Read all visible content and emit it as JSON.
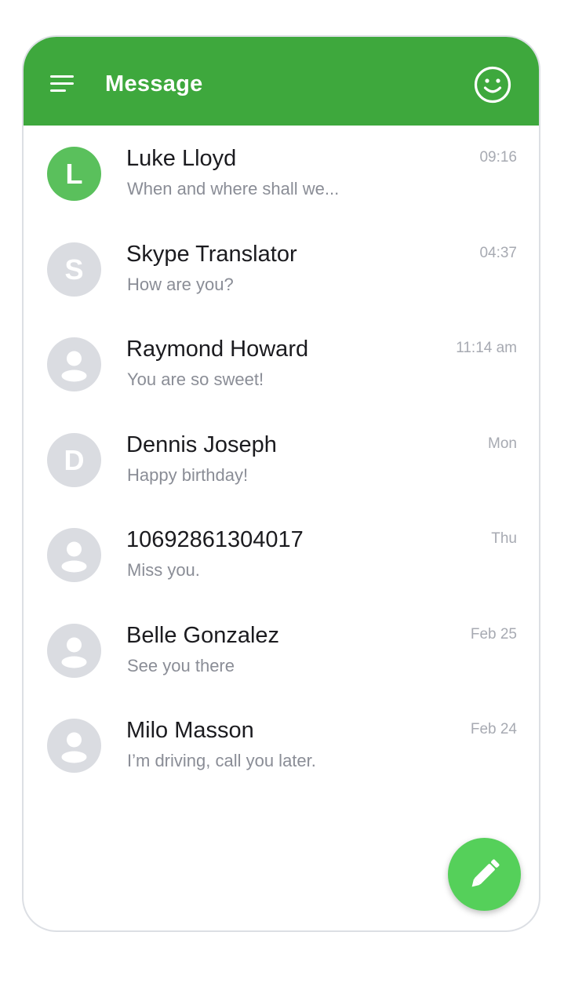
{
  "header": {
    "title": "Message",
    "menu_icon": "hamburger-menu-icon",
    "action_icon": "smiley-face-icon",
    "color": "#3ea83d"
  },
  "conversations": [
    {
      "avatar_type": "letter",
      "avatar_letter": "L",
      "avatar_color": "#5ac05c",
      "name": "Luke Lloyd",
      "preview": "When and where shall we...",
      "time": "09:16"
    },
    {
      "avatar_type": "letter",
      "avatar_letter": "S",
      "avatar_color": "#dadce1",
      "name": "Skype Translator",
      "preview": "How are you?",
      "time": "04:37"
    },
    {
      "avatar_type": "person",
      "avatar_letter": "",
      "avatar_color": "#dadce1",
      "name": "Raymond Howard",
      "preview": "You are so sweet!",
      "time": "11:14 am"
    },
    {
      "avatar_type": "letter",
      "avatar_letter": "D",
      "avatar_color": "#dadce1",
      "name": "Dennis Joseph",
      "preview": "Happy birthday!",
      "time": "Mon"
    },
    {
      "avatar_type": "person",
      "avatar_letter": "",
      "avatar_color": "#dadce1",
      "name": "10692861304017",
      "preview": "Miss you.",
      "time": "Thu"
    },
    {
      "avatar_type": "person",
      "avatar_letter": "",
      "avatar_color": "#dadce1",
      "name": "Belle Gonzalez",
      "preview": "See you there",
      "time": "Feb 25"
    },
    {
      "avatar_type": "person",
      "avatar_letter": "",
      "avatar_color": "#dadce1",
      "name": "Milo Masson",
      "preview": "I’m driving, call you later.",
      "time": "Feb 24"
    }
  ],
  "fab": {
    "icon": "pencil-icon",
    "color": "#55d05a"
  }
}
